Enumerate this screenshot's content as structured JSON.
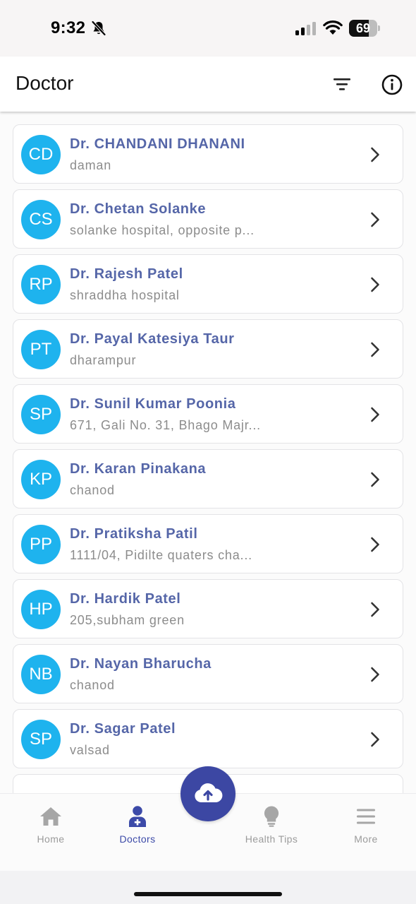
{
  "status_bar": {
    "time": "9:32",
    "battery": "69",
    "battery_level": 0.69,
    "icons": [
      "bell-slash-icon",
      "signal-icon",
      "wifi-icon",
      "battery-icon"
    ]
  },
  "header": {
    "title": "Doctor",
    "icons": [
      "filter-icon",
      "info-icon"
    ]
  },
  "colors": {
    "avatar": "#1eb3ee",
    "name": "#5566a8",
    "accent": "#3c47a3"
  },
  "doctors": [
    {
      "initials": "CD",
      "name": "Dr. CHANDANI DHANANI",
      "address": "daman"
    },
    {
      "initials": "CS",
      "name": "Dr. Chetan Solanke",
      "address": "solanke hospital, opposite p..."
    },
    {
      "initials": "RP",
      "name": "Dr. Rajesh Patel",
      "address": "shraddha hospital"
    },
    {
      "initials": "PT",
      "name": "Dr. Payal Katesiya Taur",
      "address": "dharampur"
    },
    {
      "initials": "SP",
      "name": "Dr. Sunil Kumar Poonia",
      "address": "671, Gali No. 31, Bhago Majr..."
    },
    {
      "initials": "KP",
      "name": "Dr. Karan Pinakana",
      "address": "chanod"
    },
    {
      "initials": "PP",
      "name": "Dr. Pratiksha Patil",
      "address": "1111/04, Pidilte quaters cha..."
    },
    {
      "initials": "HP",
      "name": "Dr. Hardik Patel",
      "address": "205,subham green"
    },
    {
      "initials": "NB",
      "name": "Dr. Nayan Bharucha",
      "address": "chanod"
    },
    {
      "initials": "SP",
      "name": "Dr. Sagar Patel",
      "address": "valsad"
    }
  ],
  "bottom_nav": {
    "items": [
      {
        "label": "Home",
        "icon": "home-icon"
      },
      {
        "label": "Doctors",
        "icon": "doctor-icon",
        "active": true
      },
      {
        "label": "Health Tips",
        "icon": "lightbulb-icon"
      },
      {
        "label": "More",
        "icon": "menu-icon"
      }
    ],
    "fab_icon": "cloud-upload-icon"
  }
}
